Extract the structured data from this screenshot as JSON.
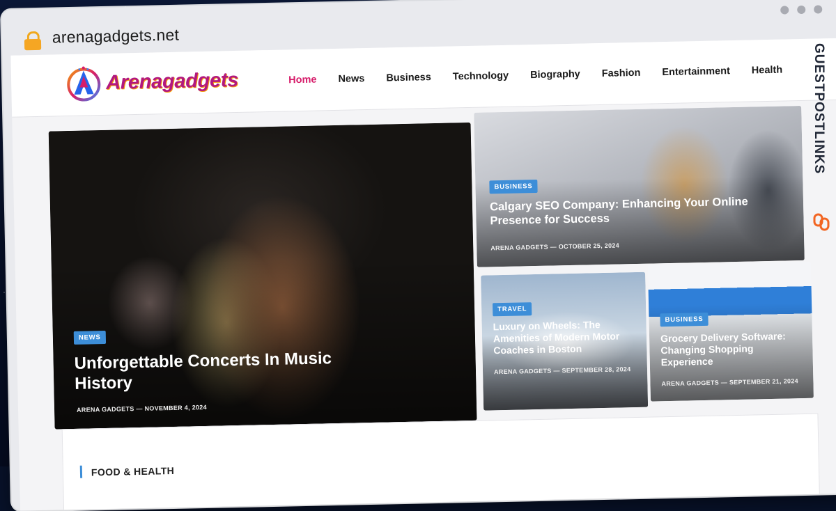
{
  "browser": {
    "url": "arenagadgets.net"
  },
  "site": {
    "logo_text": "Arenagadgets",
    "nav": [
      "Home",
      "News",
      "Business",
      "Technology",
      "Biography",
      "Fashion",
      "Entertainment",
      "Health"
    ],
    "active_nav": "Home"
  },
  "featured": {
    "main": {
      "badge": "NEWS",
      "title": "Unforgettable Concerts In Music History",
      "author": "ARENA GADGETS",
      "date": "NOVEMBER 4, 2024"
    },
    "seo": {
      "badge": "BUSINESS",
      "title": "Calgary SEO Company: Enhancing Your Online Presence for Success",
      "author": "ARENA GADGETS",
      "date": "OCTOBER 25, 2024"
    },
    "travel": {
      "badge": "TRAVEL",
      "title": "Luxury on Wheels: The Amenities of Modern Motor Coaches in Boston",
      "author": "ARENA GADGETS",
      "date": "SEPTEMBER 28, 2024"
    },
    "grocery": {
      "badge": "BUSINESS",
      "title": "Grocery Delivery Software: Changing Shopping Experience",
      "author": "ARENA GADGETS",
      "date": "SEPTEMBER 21, 2024"
    }
  },
  "section": {
    "title": "FOOD & HEALTH"
  },
  "watermark": {
    "text": "GUESTPOSTLINKS"
  },
  "colors": {
    "accent": "#d61c6a",
    "badge": "#3d8ed8",
    "lock": "#f5a623"
  }
}
